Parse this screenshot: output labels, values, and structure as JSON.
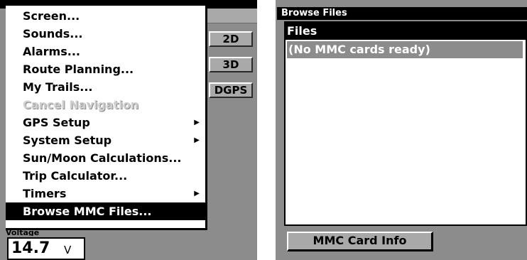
{
  "left": {
    "fix_buttons": {
      "b2d": "2D",
      "b3d": "3D",
      "dgps": "DGPS"
    },
    "menu": {
      "items": [
        {
          "label": "Screen..."
        },
        {
          "label": "Sounds..."
        },
        {
          "label": "Alarms..."
        },
        {
          "label": "Route Planning..."
        },
        {
          "label": "My Trails..."
        },
        {
          "label": "Cancel Navigation",
          "disabled": true
        },
        {
          "label": "GPS Setup",
          "submenu": true
        },
        {
          "label": "System Setup",
          "submenu": true
        },
        {
          "label": "Sun/Moon Calculations..."
        },
        {
          "label": "Trip Calculator..."
        },
        {
          "label": "Timers",
          "submenu": true
        },
        {
          "label": "Browse MMC Files...",
          "selected": true
        }
      ],
      "submenu_arrow": "▶"
    },
    "voltage": {
      "caption": "Voltage",
      "value": "14.7",
      "unit": "V"
    }
  },
  "right": {
    "title": "Browse Files",
    "files_header": "Files",
    "files_row": "(No MMC cards ready)",
    "mmc_info_button": "MMC Card Info"
  },
  "colors": {
    "background_gray": "#8c8c8c",
    "button_gray": "#a9a9a9",
    "highlight": "#000000"
  }
}
